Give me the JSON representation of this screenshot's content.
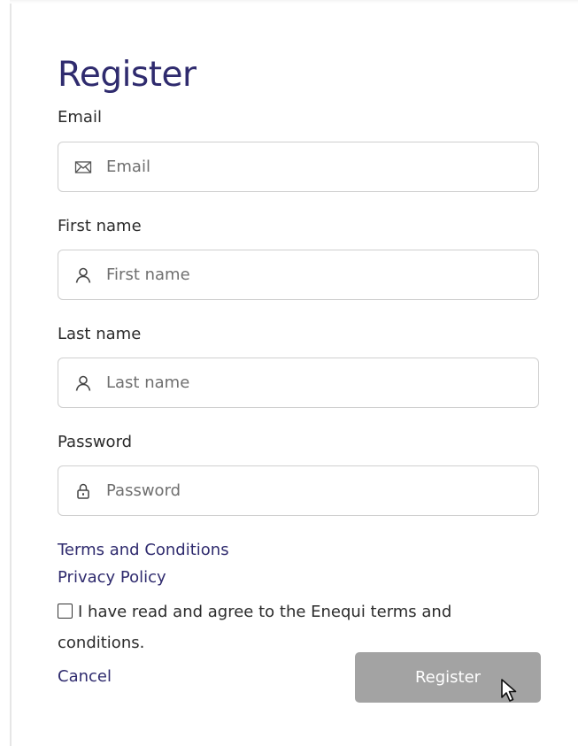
{
  "form": {
    "title": "Register",
    "email": {
      "label": "Email",
      "placeholder": "Email",
      "icon": "envelope-icon"
    },
    "first_name": {
      "label": "First name",
      "placeholder": "First name",
      "icon": "user-icon"
    },
    "last_name": {
      "label": "Last name",
      "placeholder": "Last name",
      "icon": "user-icon"
    },
    "password": {
      "label": "Password",
      "placeholder": "Password",
      "icon": "lock-icon"
    },
    "terms_link": "Terms and Conditions",
    "privacy_link": "Privacy Policy",
    "agree_text": "I have read and agree to the Enequi terms and conditions.",
    "agree_checked": false,
    "cancel_label": "Cancel",
    "register_label": "Register"
  },
  "colors": {
    "accent": "#2f2b6e",
    "button_disabled": "#a3a3a3",
    "border": "#cfcfcf"
  }
}
